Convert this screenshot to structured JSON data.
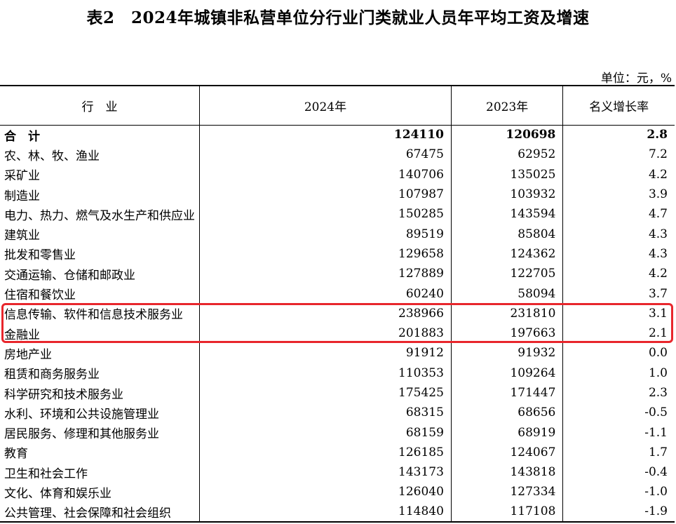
{
  "title": "表2　2024年城镇非私营单位分行业门类就业人员年平均工资及增速",
  "unit": "单位：元，%",
  "headers": [
    "行　业",
    "2024年",
    "2023年",
    "名义增长率"
  ],
  "rows": [
    {
      "industry": "合　计",
      "y2024": "124110",
      "y2023": "120698",
      "growth": "2.8"
    },
    {
      "industry": "农、林、牧、渔业",
      "y2024": "67475",
      "y2023": "62952",
      "growth": "7.2"
    },
    {
      "industry": "采矿业",
      "y2024": "140706",
      "y2023": "135025",
      "growth": "4.2"
    },
    {
      "industry": "制造业",
      "y2024": "107987",
      "y2023": "103932",
      "growth": "3.9"
    },
    {
      "industry": "电力、热力、燃气及水生产和供应业",
      "y2024": "150285",
      "y2023": "143594",
      "growth": "4.7"
    },
    {
      "industry": "建筑业",
      "y2024": "89519",
      "y2023": "85804",
      "growth": "4.3"
    },
    {
      "industry": "批发和零售业",
      "y2024": "129658",
      "y2023": "124362",
      "growth": "4.3"
    },
    {
      "industry": "交通运输、仓储和邮政业",
      "y2024": "127889",
      "y2023": "122705",
      "growth": "4.2"
    },
    {
      "industry": "住宿和餐饮业",
      "y2024": "60240",
      "y2023": "58094",
      "growth": "3.7"
    },
    {
      "industry": "信息传输、软件和信息技术服务业",
      "y2024": "238966",
      "y2023": "231810",
      "growth": "3.1"
    },
    {
      "industry": "金融业",
      "y2024": "201883",
      "y2023": "197663",
      "growth": "2.1"
    },
    {
      "industry": "房地产业",
      "y2024": "91912",
      "y2023": "91932",
      "growth": "0.0"
    },
    {
      "industry": "租赁和商务服务业",
      "y2024": "110353",
      "y2023": "109264",
      "growth": "1.0"
    },
    {
      "industry": "科学研究和技术服务业",
      "y2024": "175425",
      "y2023": "171447",
      "growth": "2.3"
    },
    {
      "industry": "水利、环境和公共设施管理业",
      "y2024": "68315",
      "y2023": "68656",
      "growth": "-0.5"
    },
    {
      "industry": "居民服务、修理和其他服务业",
      "y2024": "68159",
      "y2023": "68919",
      "growth": "-1.1"
    },
    {
      "industry": "教育",
      "y2024": "126185",
      "y2023": "124067",
      "growth": "1.7"
    },
    {
      "industry": "卫生和社会工作",
      "y2024": "143173",
      "y2023": "143818",
      "growth": "-0.4"
    },
    {
      "industry": "文化、体育和娱乐业",
      "y2024": "126040",
      "y2023": "127334",
      "growth": "-1.0"
    },
    {
      "industry": "公共管理、社会保障和社会组织",
      "y2024": "114840",
      "y2023": "117108",
      "growth": "-1.9"
    }
  ],
  "highlight_color": "#e8262c"
}
